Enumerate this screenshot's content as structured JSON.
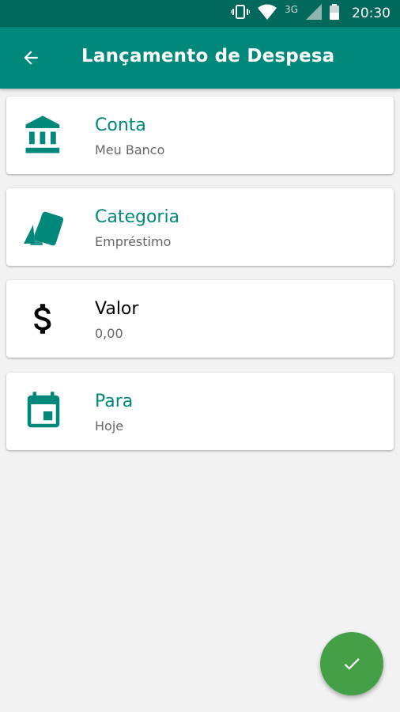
{
  "status_bar": {
    "network": "3G",
    "time": "20:30"
  },
  "app_bar": {
    "title": "Lançamento de Despesa"
  },
  "colors": {
    "primary": "#00897b",
    "primary_dark": "#00695c",
    "accent": "#00897b",
    "fab": "#43a047"
  },
  "fields": [
    {
      "icon": "bank-icon",
      "label": "Conta",
      "value": "Meu Banco",
      "label_color": "#00897b"
    },
    {
      "icon": "category-cards-icon",
      "label": "Categoria",
      "value": "Empréstimo",
      "label_color": "#00897b"
    },
    {
      "icon": "dollar-icon",
      "label": "Valor",
      "value": "0,00",
      "label_color": "#000000"
    },
    {
      "icon": "calendar-icon",
      "label": "Para",
      "value": "Hoje",
      "label_color": "#00897b"
    }
  ],
  "fab": {
    "icon": "check-icon"
  }
}
